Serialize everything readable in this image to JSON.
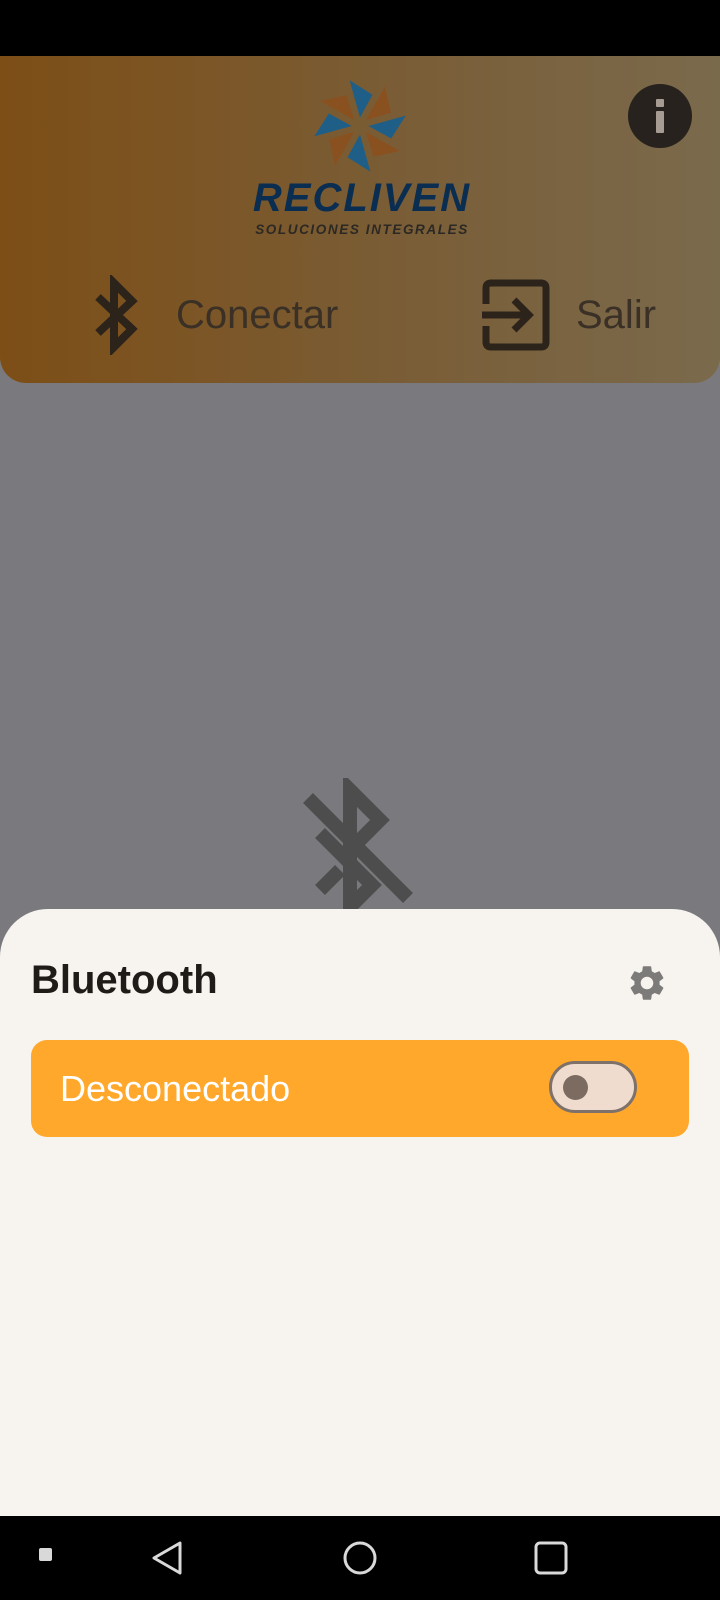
{
  "header": {
    "logo": {
      "wordmark": "RECLIVEN",
      "tagline": "SOLUCIONES INTEGRALES"
    },
    "info_icon": "info-icon",
    "connect_label": "Conectar",
    "connect_icon": "bluetooth-icon",
    "exit_label": "Salir",
    "exit_icon": "exit-icon"
  },
  "background": {
    "icon": "bluetooth-disabled-icon"
  },
  "sheet": {
    "title": "Bluetooth",
    "settings_icon": "gear-icon",
    "status_label": "Desconectado",
    "toggle_on": false
  },
  "colors": {
    "accent": "#ffa82c",
    "header_brown": "#7d4e16",
    "logo_blue": "#0a2d52",
    "sheet_bg": "#f7f4f0"
  },
  "nav_bar": {
    "icons": [
      "square-small-icon",
      "back-icon",
      "home-icon",
      "recents-icon"
    ]
  }
}
